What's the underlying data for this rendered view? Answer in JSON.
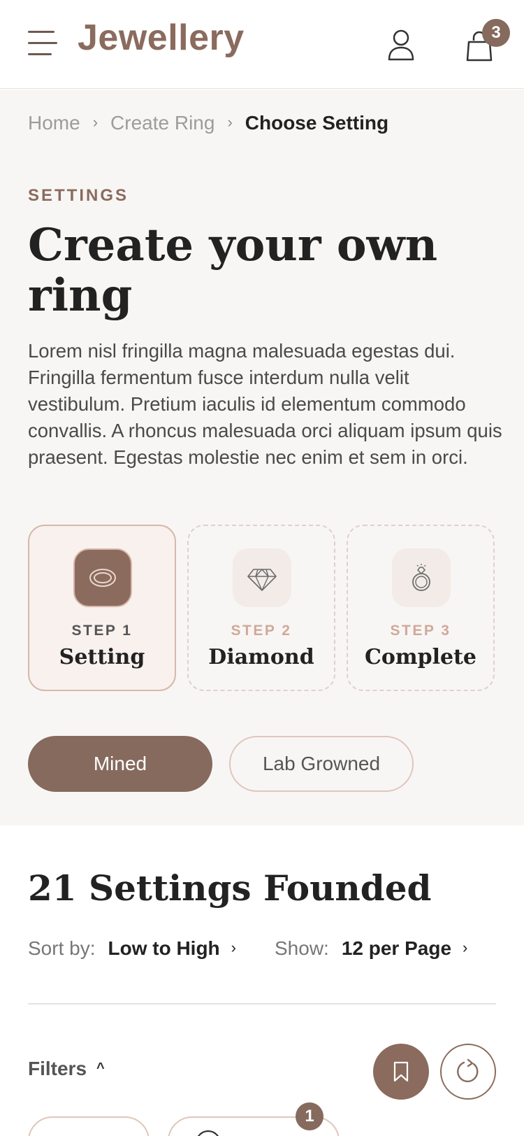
{
  "header": {
    "logo": "Jewellery",
    "cart_count": "3",
    "icons": {
      "menu": "hamburger-menu-icon",
      "user": "user-icon",
      "cart": "shopping-bag-icon"
    }
  },
  "breadcrumb": {
    "items": [
      "Home",
      "Create Ring"
    ],
    "current": "Choose Setting",
    "separator": "›"
  },
  "hero": {
    "eyebrow": "SETTINGS",
    "title": "Create your own ring",
    "description": "Lorem nisl fringilla magna malesuada egestas dui. Fringilla fermentum fusce interdum nulla velit vestibulum. Pretium iaculis id elementum commodo convallis. A rhoncus malesuada orci aliquam ipsum quis praesent. Egestas molestie nec enim et sem in orci."
  },
  "steps": [
    {
      "label": "STEP 1",
      "name": "Setting",
      "icon": "ring-band-icon",
      "active": true
    },
    {
      "label": "STEP 2",
      "name": "Diamond",
      "icon": "diamond-icon",
      "active": false
    },
    {
      "label": "STEP 3",
      "name": "Complete",
      "icon": "diamond-ring-icon",
      "active": false
    }
  ],
  "origin_toggle": {
    "options": [
      "Mined",
      "Lab Growned"
    ],
    "selected": "Mined"
  },
  "results": {
    "title": "21 Settings Founded",
    "sort_label": "Sort by:",
    "sort_value": "Low to High",
    "show_label": "Show:",
    "show_value": "12 per Page"
  },
  "filters": {
    "label": "Filters",
    "chip_badge": "1",
    "icons": {
      "bookmark": "bookmark-icon",
      "reset": "refresh-icon"
    }
  },
  "colors": {
    "accent": "#856a5d",
    "accent_light": "#d8b7aa",
    "hero_bg": "#f8f6f5"
  }
}
